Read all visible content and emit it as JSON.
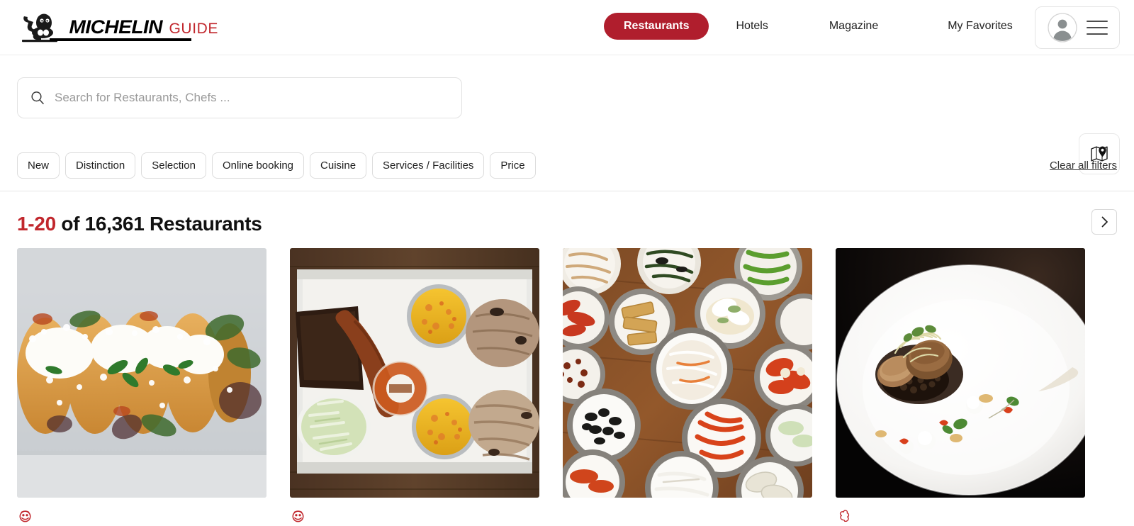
{
  "header": {
    "logo": {
      "icon": "michelin-bibendum-logo",
      "wordmark": "MICHELIN",
      "guide": "GUIDE"
    },
    "nav": [
      {
        "label": "Restaurants",
        "active": true
      },
      {
        "label": "Hotels",
        "active": false
      },
      {
        "label": "Magazine",
        "active": false
      },
      {
        "label": "My Favorites",
        "active": false
      }
    ],
    "account": {
      "avatar_icon": "user-avatar-icon",
      "menu_icon": "hamburger-menu-icon"
    },
    "accent_color": "#b01e2d",
    "brand_red": "#c1272d"
  },
  "search": {
    "icon": "search-icon",
    "placeholder": "Search for Restaurants, Chefs ...",
    "value": "",
    "map_button_icon": "map-pin-icon"
  },
  "filters": {
    "chips": [
      "New",
      "Distinction",
      "Selection",
      "Online booking",
      "Cuisine",
      "Services / Facilities",
      "Price"
    ],
    "clear_label": "Clear all filters"
  },
  "results": {
    "range": "1-20",
    "suffix": "of 16,361 Restaurants",
    "next_page_icon": "chevron-right-icon",
    "cards": [
      {
        "photo_alt": "Fried masa boats topped with queso fresco and cilantro on a gray slate board",
        "distinction": "bib-gourmand"
      },
      {
        "photo_alt": "Barbecue tray with brisket, sausage, pulled pork, mac and cheese, coleslaw and sauce on dark wood",
        "distinction": "bib-gourmand"
      },
      {
        "photo_alt": "Korean banchan spread of many small side dish bowls on a wooden table",
        "distinction": "none"
      },
      {
        "photo_alt": "Fine dining plate with seared meat medallions, dark jus, puree dots and microgreens",
        "distinction": "michelin-star"
      }
    ]
  }
}
